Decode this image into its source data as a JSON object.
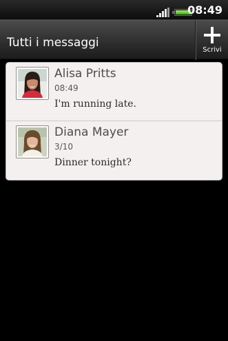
{
  "status_bar": {
    "time": "08:49",
    "signal_icon": "signal-strength-icon",
    "battery_icon": "battery-icon"
  },
  "header": {
    "title": "Tutti i messaggi",
    "compose_label": "Scrivi",
    "compose_icon": "plus-icon"
  },
  "messages": [
    {
      "name": "Alisa Pritts",
      "time": "08:49",
      "preview": "I'm running late."
    },
    {
      "name": "Diana Mayer",
      "time": "3/10",
      "preview": "Dinner tonight?"
    }
  ],
  "colors": {
    "list_background": "#f4f0f0",
    "background": "#000000",
    "title_bar": "#343434"
  }
}
